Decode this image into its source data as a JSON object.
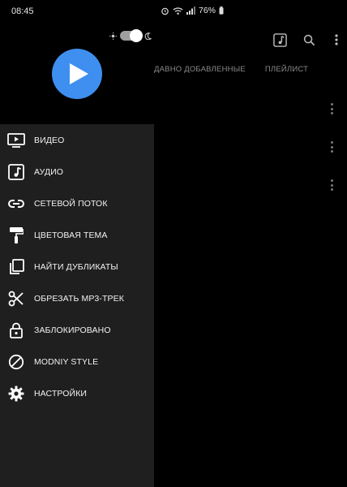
{
  "status_bar": {
    "time": "08:45",
    "battery": "76%"
  },
  "header": {
    "tabs": [
      "ДАВНО ДОБАВЛЕННЫЕ",
      "ПЛЕЙЛИСТ"
    ],
    "actions": [
      "music-note-icon",
      "search-icon",
      "more-vert-icon"
    ]
  },
  "theme_toggle": {
    "state": "dark"
  },
  "drawer": {
    "items": [
      {
        "label": "ВИДЕО",
        "icon": "video-icon"
      },
      {
        "label": "АУДИО",
        "icon": "music-note-icon"
      },
      {
        "label": "СЕТЕВОЙ ПОТОК",
        "icon": "link-icon"
      },
      {
        "label": "ЦВЕТОВАЯ ТЕМА",
        "icon": "paint-roller-icon"
      },
      {
        "label": "НАЙТИ ДУБЛИКАТЫ",
        "icon": "copy-icon"
      },
      {
        "label": "ОБРЕЗАТЬ MP3-ТРЕК",
        "icon": "scissors-icon"
      },
      {
        "label": "ЗАБЛОКИРОВАНО",
        "icon": "lock-icon"
      },
      {
        "label": "MODNIY STYLE",
        "icon": "block-icon"
      },
      {
        "label": "НАСТРОЙКИ",
        "icon": "gear-icon"
      }
    ]
  },
  "colors": {
    "accent": "#3f8ff0",
    "drawer_bg": "#1f1f1f",
    "background": "#000000"
  }
}
